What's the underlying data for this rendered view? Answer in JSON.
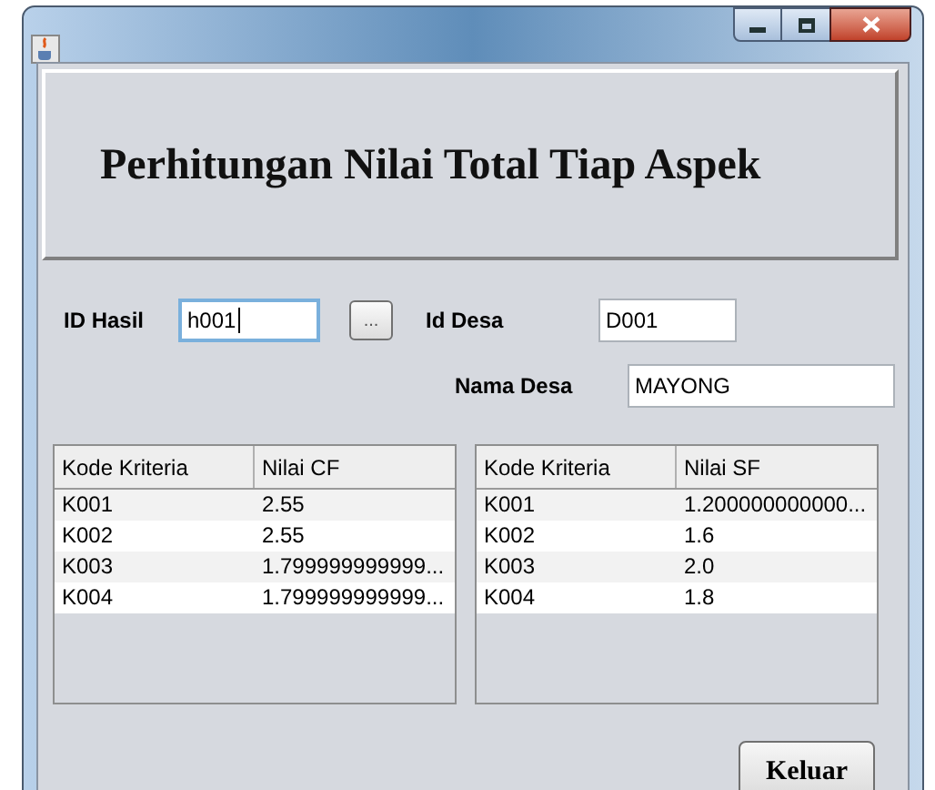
{
  "header": {
    "title": "Perhitungan Nilai Total Tiap Aspek"
  },
  "id_hasil": {
    "label": "ID Hasil",
    "value": "h001",
    "focused": true
  },
  "browse_button": {
    "label": "..."
  },
  "id_desa": {
    "label": "Id Desa",
    "value": "D001",
    "focused": false
  },
  "nama_desa": {
    "label": "Nama Desa",
    "value": "MAYONG",
    "focused": false
  },
  "table_cf": {
    "columns": [
      "Kode Kriteria",
      "Nilai CF"
    ],
    "rows": [
      [
        "K001",
        "2.55"
      ],
      [
        "K002",
        "2.55"
      ],
      [
        "K003",
        "1.799999999999..."
      ],
      [
        "K004",
        "1.799999999999..."
      ]
    ]
  },
  "table_sf": {
    "columns": [
      "Kode Kriteria",
      "Nilai SF"
    ],
    "rows": [
      [
        "K001",
        "1.200000000000..."
      ],
      [
        "K002",
        "1.6"
      ],
      [
        "K003",
        "2.0"
      ],
      [
        "K004",
        "1.8"
      ]
    ]
  },
  "exit_button": {
    "label": "Keluar"
  }
}
